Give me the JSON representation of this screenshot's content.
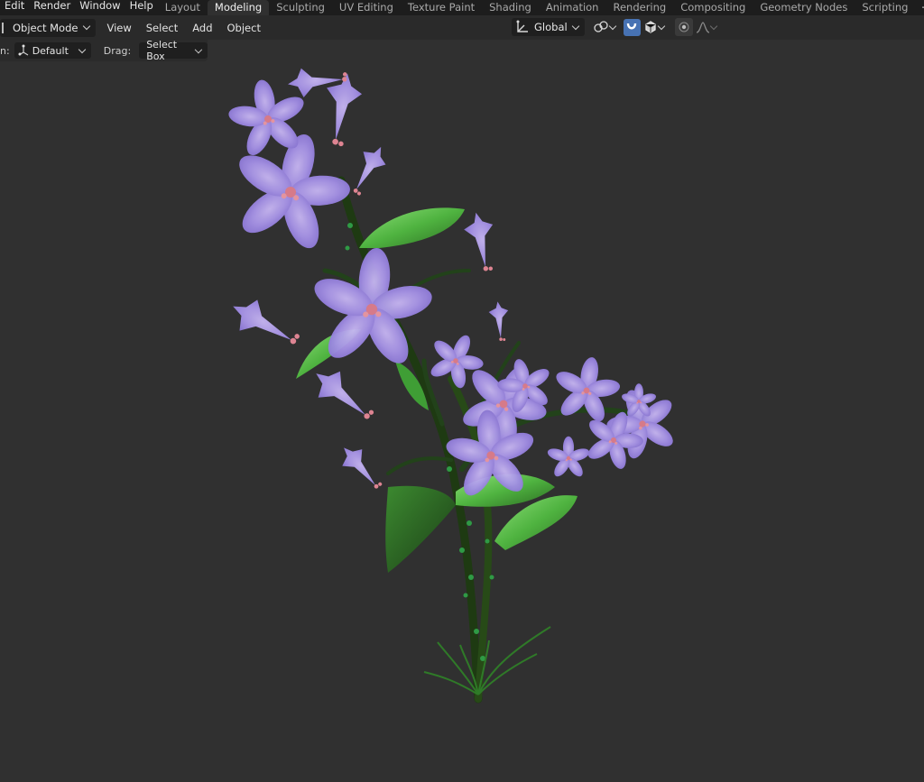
{
  "menus": [
    "Edit",
    "Render",
    "Window",
    "Help"
  ],
  "workspace_tabs": [
    "Layout",
    "Modeling",
    "Sculpting",
    "UV Editing",
    "Texture Paint",
    "Shading",
    "Animation",
    "Rendering",
    "Compositing",
    "Geometry Nodes",
    "Scripting"
  ],
  "active_tab": "Modeling",
  "add_tab_icon": "plus-icon",
  "header": {
    "mode": "Object Mode",
    "menu_items": [
      "View",
      "Select",
      "Add",
      "Object"
    ],
    "transform_orientation": "Global"
  },
  "toolbar": {
    "orientation_prefix": "n:",
    "orientation_value": "Default",
    "drag_label": "Drag:",
    "drag_value": "Select Box"
  },
  "colors": {
    "viewport_bg": "#303030",
    "topbar_bg": "#1d1d1d",
    "accent": "#4772b3",
    "petal": "#a894e6",
    "leaf": "#5bbf4a",
    "stem": "#1e3a12"
  }
}
